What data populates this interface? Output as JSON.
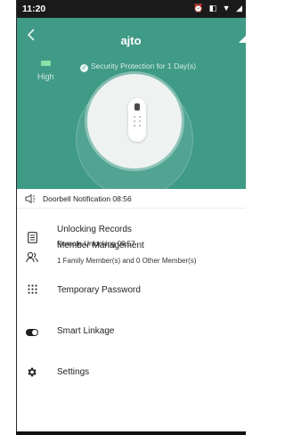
{
  "status_bar": {
    "time": "11:20",
    "icons": [
      "alarm-icon",
      "vibrate-icon",
      "wifi-icon",
      "signal-icon"
    ],
    "icons_glyphs": "⏰ ◧ ▼ ◢"
  },
  "header": {
    "title": "ajto",
    "back_icon": "chevron-left-icon",
    "top_right_icon": "signal-icon"
  },
  "hero": {
    "battery_label": "High",
    "protection_text": "Security Protection for 1 Day(s)",
    "colors": {
      "background": "#3f9a86",
      "battery": "#8be0a7"
    }
  },
  "notification": {
    "icon": "speaker-icon",
    "text": "Doorbell Notification 08:56"
  },
  "menu": {
    "items": [
      {
        "icon": "document-icon",
        "label": "Unlocking Records",
        "sub": "Remote Unlocking 08:57"
      },
      {
        "icon": "members-icon",
        "label": "Member Management",
        "sub": "1 Family Member(s) and 0 Other Member(s)"
      },
      {
        "icon": "keypad-icon",
        "label": "Temporary Password",
        "sub": ""
      },
      {
        "icon": "toggle-icon",
        "label": "Smart Linkage",
        "sub": ""
      },
      {
        "icon": "gear-icon",
        "label": "Settings",
        "sub": ""
      }
    ]
  }
}
